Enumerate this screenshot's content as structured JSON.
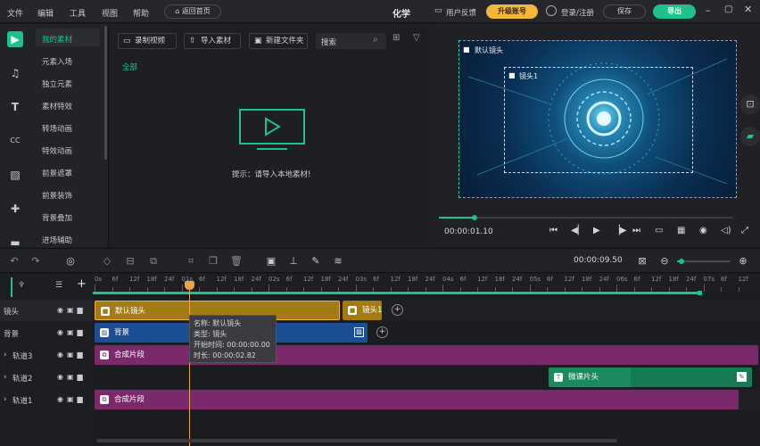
{
  "menu": {
    "file": "文件",
    "edit": "编辑",
    "tools": "工具",
    "view": "视图",
    "help": "帮助",
    "back_home": "返回首页"
  },
  "project_title": "化学",
  "header": {
    "feedback": "用户反馈",
    "upgrade": "升级账号",
    "login": "登录/注册",
    "save": "保存",
    "export": "导出"
  },
  "categories": [
    "我的素材",
    "元素入场",
    "独立元素",
    "素材特效",
    "转场动画",
    "特效动画",
    "前景遮罩",
    "前景装饰",
    "背景叠加",
    "进场辅助"
  ],
  "material": {
    "record": "录制视频",
    "import": "导入素材",
    "new_folder": "新建文件夹",
    "search_placeholder": "搜索",
    "filter_all": "全部",
    "hint": "提示：请导入本地素材!"
  },
  "preview": {
    "default_camera": "默认镜头",
    "camera1": "镜头1",
    "current_time": "00:00:01.10",
    "progress_percent": 12
  },
  "toolbar": {
    "total_time": "00:00:09.50"
  },
  "ruler_ticks": [
    "0s",
    "6f",
    "12f",
    "18f",
    "24f",
    "01s",
    "6f",
    "12f",
    "18f",
    "24f",
    "02s",
    "6f",
    "12f",
    "18f",
    "24f",
    "03s",
    "6f",
    "12f",
    "18f",
    "24f",
    "04s",
    "6f",
    "12f",
    "18f",
    "24f",
    "05s",
    "6f",
    "12f",
    "18f",
    "24f",
    "06s",
    "6f",
    "12f",
    "18f",
    "24f",
    "07s",
    "6f",
    "12f"
  ],
  "tracks": [
    {
      "label": "镜头"
    },
    {
      "label": "背景"
    },
    {
      "label": "轨道3"
    },
    {
      "label": "轨道2"
    },
    {
      "label": "轨道1"
    }
  ],
  "clips": {
    "default_camera": "默认镜头",
    "camera1": "镜头1",
    "background": "背景",
    "composite3": "合成片段",
    "weike_title": "微课片头",
    "composite1": "合成片段"
  },
  "tooltip": {
    "name": "名称: 默认镜头",
    "type": "类型: 镜头",
    "start": "开始时间: 00:00:00.00",
    "duration": "时长: 00:00:02.82"
  },
  "colors": {
    "accent": "#1fc08a",
    "upgrade": "#f4b73c",
    "camera_clip": "#a27a16",
    "bg_clip": "#1b4f92",
    "composite_clip": "#7a2a6b",
    "title_clip": "#1b8a60",
    "playhead": "#e8a54b"
  }
}
